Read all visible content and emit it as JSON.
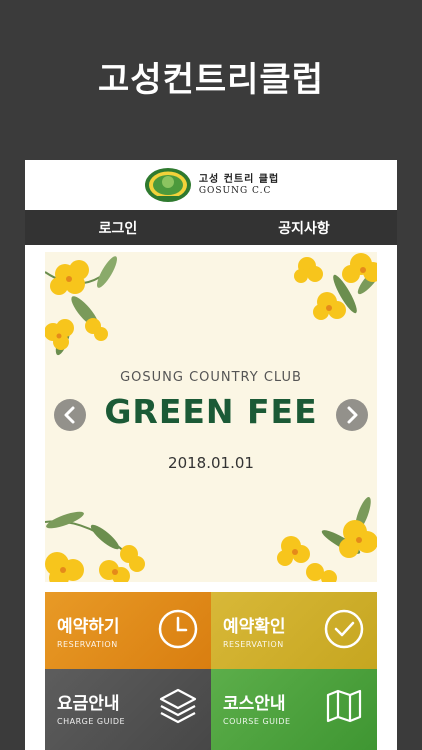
{
  "app_title": "고성컨트리클럽",
  "logo": {
    "name_ko": "고성 컨트리 클럽",
    "name_en": "GOSUNG C.C"
  },
  "nav": {
    "login": "로그인",
    "notice": "공지사항"
  },
  "banner": {
    "subtitle": "GOSUNG COUNTRY CLUB",
    "title": "GREEN FEE",
    "date": "2018.01.01"
  },
  "tiles": [
    {
      "label": "예약하기",
      "sub": "RESERVATION",
      "icon": "clock-icon",
      "color": "#e08a1a"
    },
    {
      "label": "예약확인",
      "sub": "RESERVATION",
      "icon": "check-circle-icon",
      "color": "#cfb02a"
    },
    {
      "label": "요금안내",
      "sub": "CHARGE GUIDE",
      "icon": "layers-icon",
      "color": "#525252"
    },
    {
      "label": "코스안내",
      "sub": "COURSE GUIDE",
      "icon": "map-icon",
      "color": "#4ea23e"
    }
  ],
  "colors": {
    "background": "#3b3b3b",
    "nav": "#333333",
    "banner_text": "#1b5a36",
    "banner_bg": "#fbf6e4"
  }
}
